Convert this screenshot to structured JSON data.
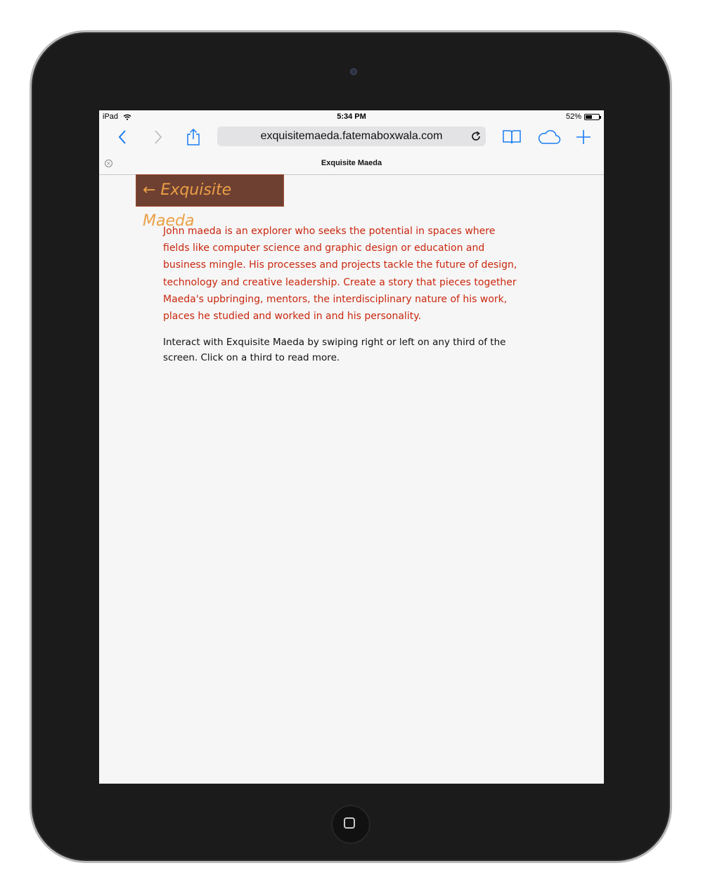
{
  "status": {
    "device": "iPad",
    "time": "5:34 PM",
    "battery": "52%",
    "battery_level": 0.52
  },
  "browser": {
    "url": "exquisitemaeda.fatemaboxwala.com",
    "tab_title": "Exquisite Maeda",
    "icons": [
      "back-icon",
      "forward-icon",
      "share-icon",
      "reload-icon",
      "bookmarks-icon",
      "icloud-tabs-icon",
      "new-tab-icon"
    ],
    "accent": "#1a7cf2"
  },
  "page": {
    "back_button": "← Exquisite Maeda",
    "intro": "John maeda is an explorer who seeks the potential in spaces where fields like computer science and graphic design or education and business mingle. His processes and projects tackle the future of design, technology and creative leadership. Create a story that pieces together Maeda's upbringing, mentors, the interdisciplinary nature of his work, places he studied and worked in and his personality.",
    "instructions": "Interact with Exquisite Maeda by swiping right or left on any third of the screen. Click on a third to read more.",
    "colors": {
      "button_bg": "#6e4032",
      "button_text": "#eba046",
      "intro_text": "#c9270e"
    }
  }
}
